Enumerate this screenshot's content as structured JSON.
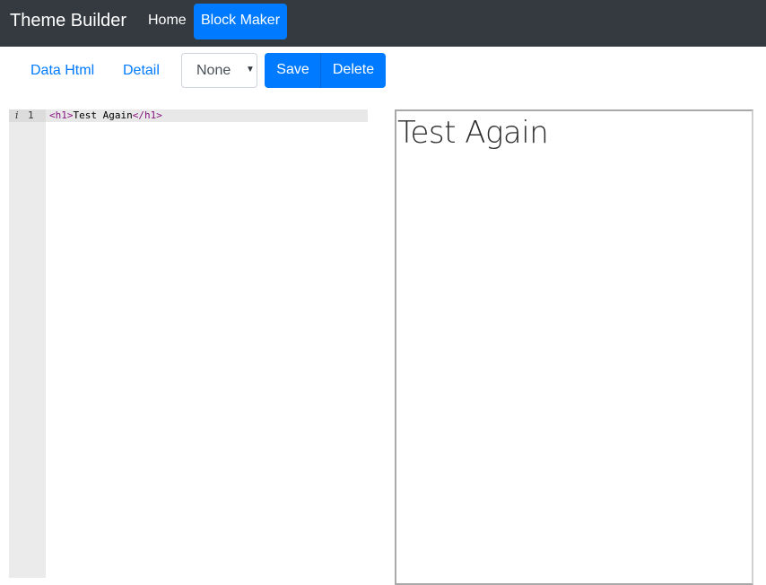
{
  "navbar": {
    "brand": "Theme Builder",
    "links": [
      {
        "label": "Home",
        "active": false
      },
      {
        "label": "Block Maker",
        "active": true
      }
    ]
  },
  "toolbar": {
    "tabs": [
      {
        "label": "Data Html"
      },
      {
        "label": "Detail"
      }
    ],
    "select": {
      "value": "None"
    },
    "save_label": "Save",
    "delete_label": "Delete"
  },
  "editor": {
    "lines": [
      {
        "number": "1",
        "open_tag": "<h1>",
        "text": "Test Again",
        "close_tag": "</h1>"
      }
    ]
  },
  "preview": {
    "heading": "Test Again"
  },
  "colors": {
    "navbar_bg": "#343a40",
    "accent": "#007bff",
    "tag": "#881280"
  }
}
